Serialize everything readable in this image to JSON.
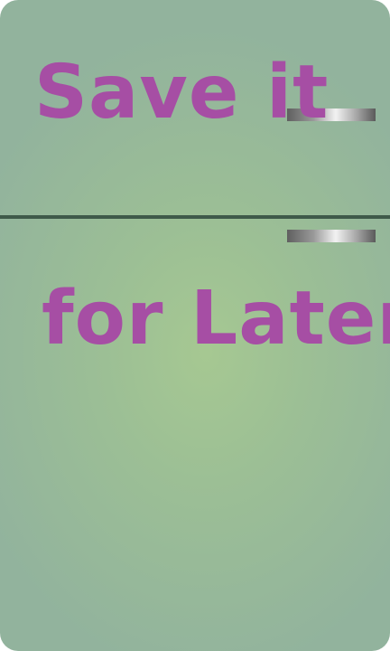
{
  "graphic": {
    "line1": "Save it",
    "line2": "for Later"
  },
  "colors": {
    "text": "#a64ea4",
    "door": "#9cbf95",
    "seam": "#3f5a4a"
  },
  "icons": {
    "handles": "fridge-handle-icon"
  }
}
